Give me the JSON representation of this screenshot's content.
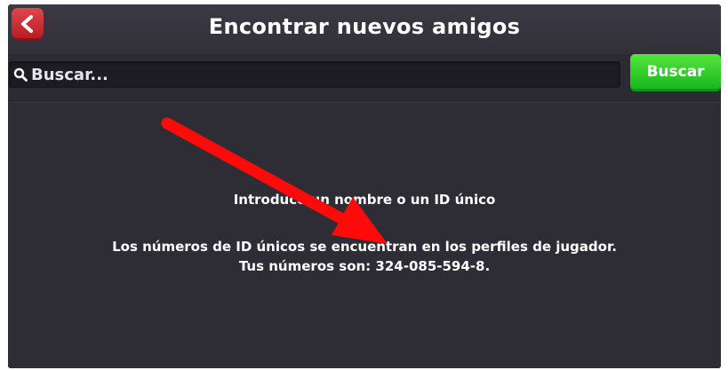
{
  "header": {
    "title": "Encontrar nuevos amigos",
    "back_icon": "chevron-left-icon",
    "back_color": "#d3282f"
  },
  "search": {
    "placeholder": "Buscar...",
    "value": "",
    "icon": "search-icon",
    "button_label": "Buscar",
    "button_color": "#2fc828"
  },
  "content": {
    "line1": "Introduce un nombre o un ID único",
    "line2": "Los números de ID únicos se encuentran en los perfiles de jugador.",
    "line3": "Tus números son: 324-085-594-8."
  },
  "annotation": {
    "arrow_color": "#ff0a0a",
    "icon": "red-arrow-annotation"
  },
  "colors": {
    "panel_background": "#2e2d36",
    "search_field": "#1d1c22"
  }
}
